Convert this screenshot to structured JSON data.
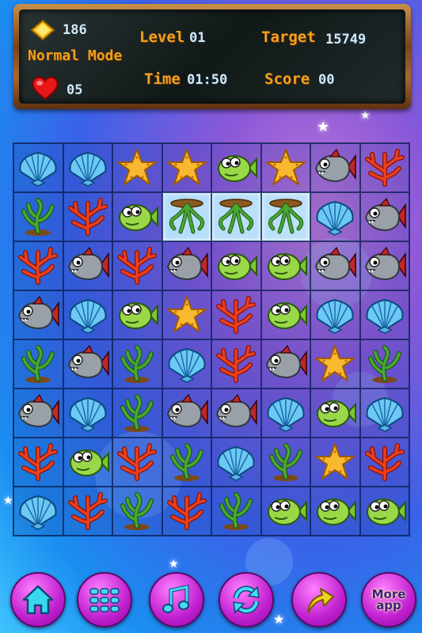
{
  "hud": {
    "gems": "186",
    "mode": "Normal Mode",
    "lives": "05",
    "level_label": "Level",
    "level_value": "01",
    "target_label": "Target",
    "target_value": "15749",
    "time_label": "Time",
    "time_value": "01:50",
    "score_label": "Score",
    "score_value": "00"
  },
  "board": {
    "rows": [
      [
        "shell",
        "shell",
        "starfish",
        "starfish",
        "greenfish",
        "starfish",
        "grayfish",
        "coral"
      ],
      [
        "seaweed",
        "coral",
        "greenfish",
        "octopus",
        "octopus",
        "octopus",
        "shell",
        "grayfish"
      ],
      [
        "coral",
        "grayfish",
        "coral",
        "grayfish",
        "greenfish",
        "greenfish",
        "grayfish",
        "grayfish"
      ],
      [
        "grayfish",
        "shell",
        "greenfish",
        "starfish",
        "coral",
        "greenfish",
        "shell",
        "shell"
      ],
      [
        "seaweed",
        "grayfish",
        "seaweed",
        "shell",
        "coral",
        "grayfish",
        "starfish",
        "seaweed"
      ],
      [
        "grayfish",
        "shell",
        "seaweed",
        "grayfish",
        "grayfish",
        "shell",
        "greenfish",
        "shell"
      ],
      [
        "coral",
        "greenfish",
        "coral",
        "seaweed",
        "shell",
        "seaweed",
        "starfish",
        "coral"
      ],
      [
        "shell",
        "coral",
        "seaweed",
        "coral",
        "seaweed",
        "greenfish",
        "greenfish",
        "greenfish"
      ]
    ],
    "selected": [
      [
        1,
        3
      ],
      [
        1,
        4
      ],
      [
        1,
        5
      ]
    ]
  },
  "buttons": [
    {
      "name": "home-button",
      "icon": "home-icon"
    },
    {
      "name": "menu-button",
      "icon": "grid-icon"
    },
    {
      "name": "music-button",
      "icon": "music-note-icon"
    },
    {
      "name": "refresh-button",
      "icon": "refresh-icon"
    },
    {
      "name": "share-button",
      "icon": "arrow-icon"
    },
    {
      "name": "more-app-button",
      "icon": "more-app-icon"
    }
  ],
  "more_app_line1": "More",
  "more_app_line2": "app"
}
